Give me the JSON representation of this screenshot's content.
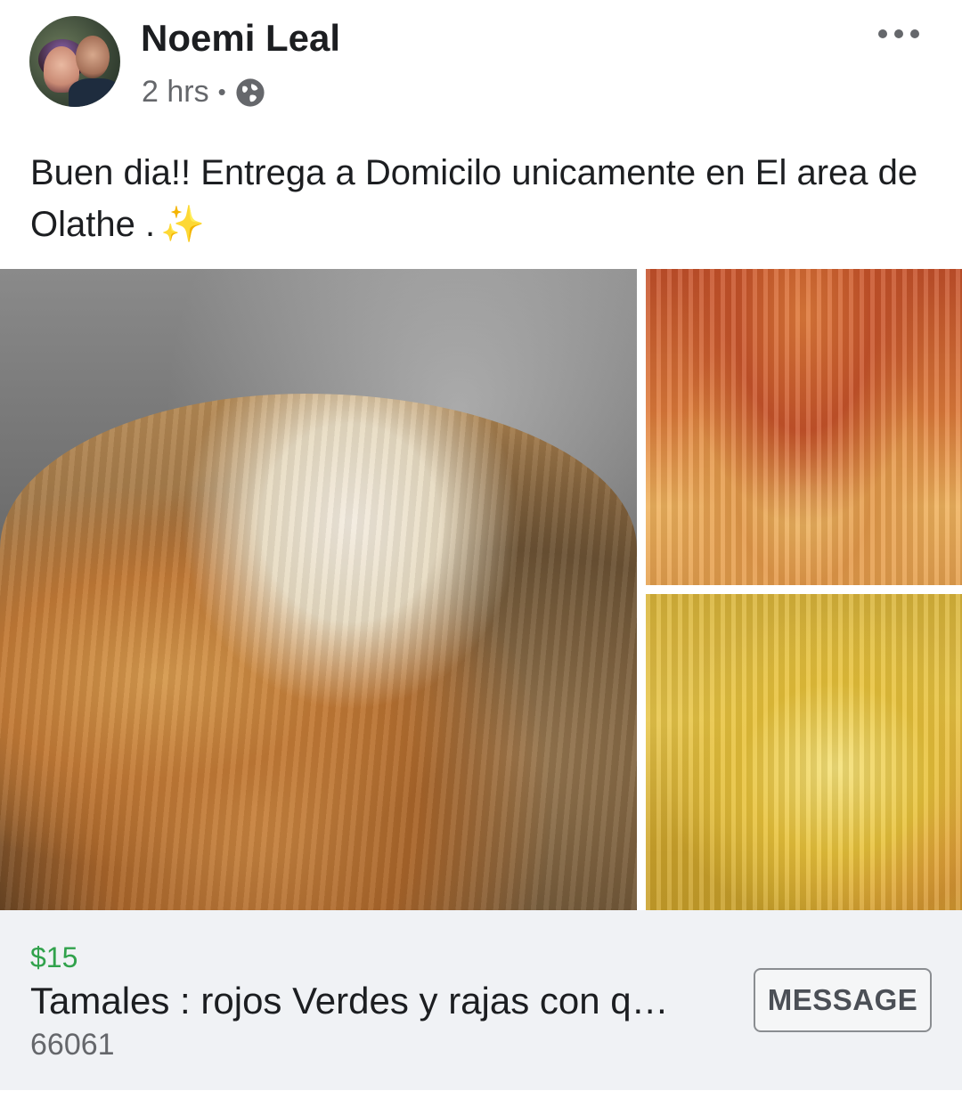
{
  "post": {
    "author": "Noemi Leal",
    "time": "2 hrs",
    "separator": "•",
    "privacy_icon": "globe-icon",
    "more_icon": "more-options-icon",
    "text": "Buen dia!! Entrega a Domicilo unicamente en El area de Olathe .",
    "emoji": "✨"
  },
  "gallery": {
    "images": [
      "tamales-pot-photo",
      "red-tamales-photo",
      "yellow-tamales-photo"
    ]
  },
  "listing": {
    "price": "$15",
    "title": "Tamales : rojos Verdes y rajas con q…",
    "location": "66061",
    "button_label": "MESSAGE"
  },
  "colors": {
    "price": "#31a24c",
    "text": "#1c1e21",
    "secondary": "#65676b",
    "listing_bg": "#f0f2f5"
  }
}
